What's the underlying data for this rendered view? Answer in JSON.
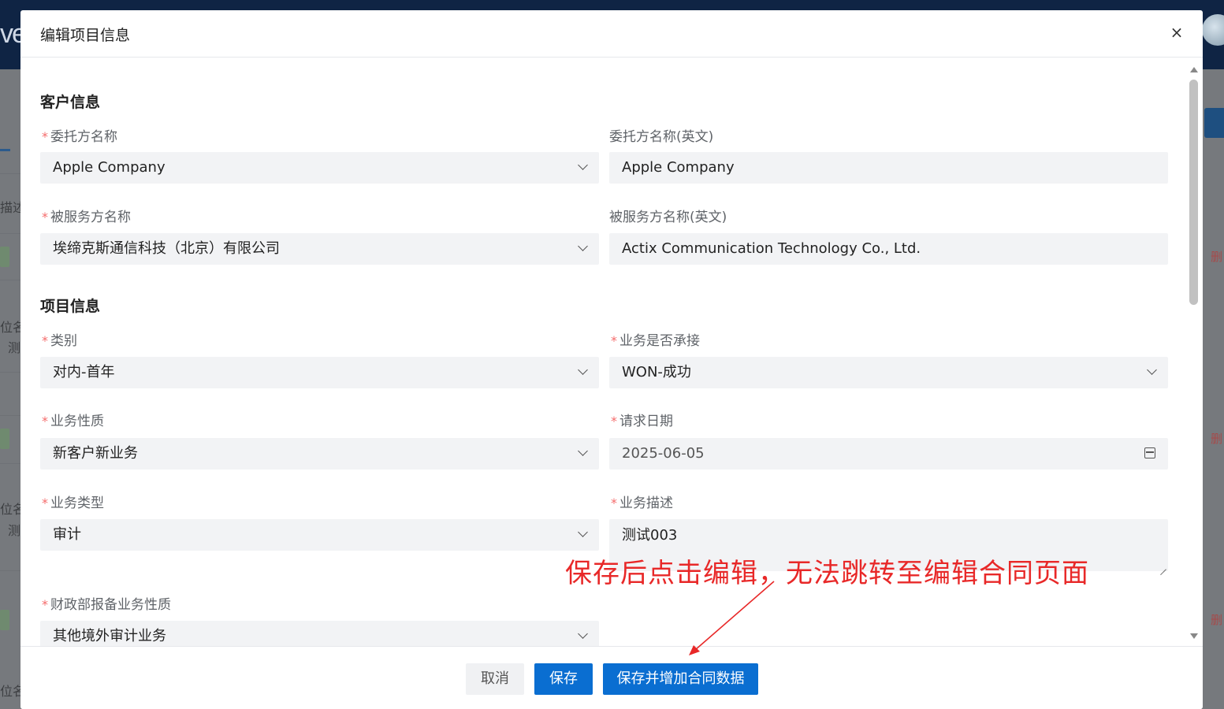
{
  "background": {
    "logo_text": "ve",
    "left_fragments": [
      "描述",
      "位名",
      "测",
      "位名",
      "测",
      "位名"
    ],
    "right_fragments": [
      "删",
      "删",
      "删"
    ],
    "right_button_label": "提"
  },
  "modal": {
    "title": "编辑项目信息",
    "close_label": "×",
    "sections": {
      "customer": {
        "title": "客户信息",
        "client_name_label": "委托方名称",
        "client_name_value": "Apple Company",
        "client_name_en_label": "委托方名称(英文)",
        "client_name_en_value": "Apple Company",
        "served_name_label": "被服务方名称",
        "served_name_value": "埃缔克斯通信科技（北京）有限公司",
        "served_name_en_label": "被服务方名称(英文)",
        "served_name_en_value": "Actix Communication Technology Co., Ltd."
      },
      "project": {
        "title": "项目信息",
        "category_label": "类别",
        "category_value": "对内-首年",
        "accepted_label": "业务是否承接",
        "accepted_value": "WON-成功",
        "nature_label": "业务性质",
        "nature_value": "新客户新业务",
        "request_date_label": "请求日期",
        "request_date_value": "2025-06-05",
        "type_label": "业务类型",
        "type_value": "审计",
        "description_label": "业务描述",
        "description_value": "测试003",
        "mof_nature_label": "财政部报备业务性质",
        "mof_nature_value": "其他境外审计业务"
      }
    },
    "required_mark": "*",
    "footer": {
      "cancel_label": "取消",
      "save_label": "保存",
      "save_add_label": "保存并增加合同数据"
    }
  },
  "annotation": {
    "text": "保存后点击编辑，无法跳转至编辑合同页面",
    "color": "#e82828"
  },
  "colors": {
    "primary": "#0a6ed1",
    "required": "#f56c6c",
    "field_bg": "#f2f3f5"
  }
}
